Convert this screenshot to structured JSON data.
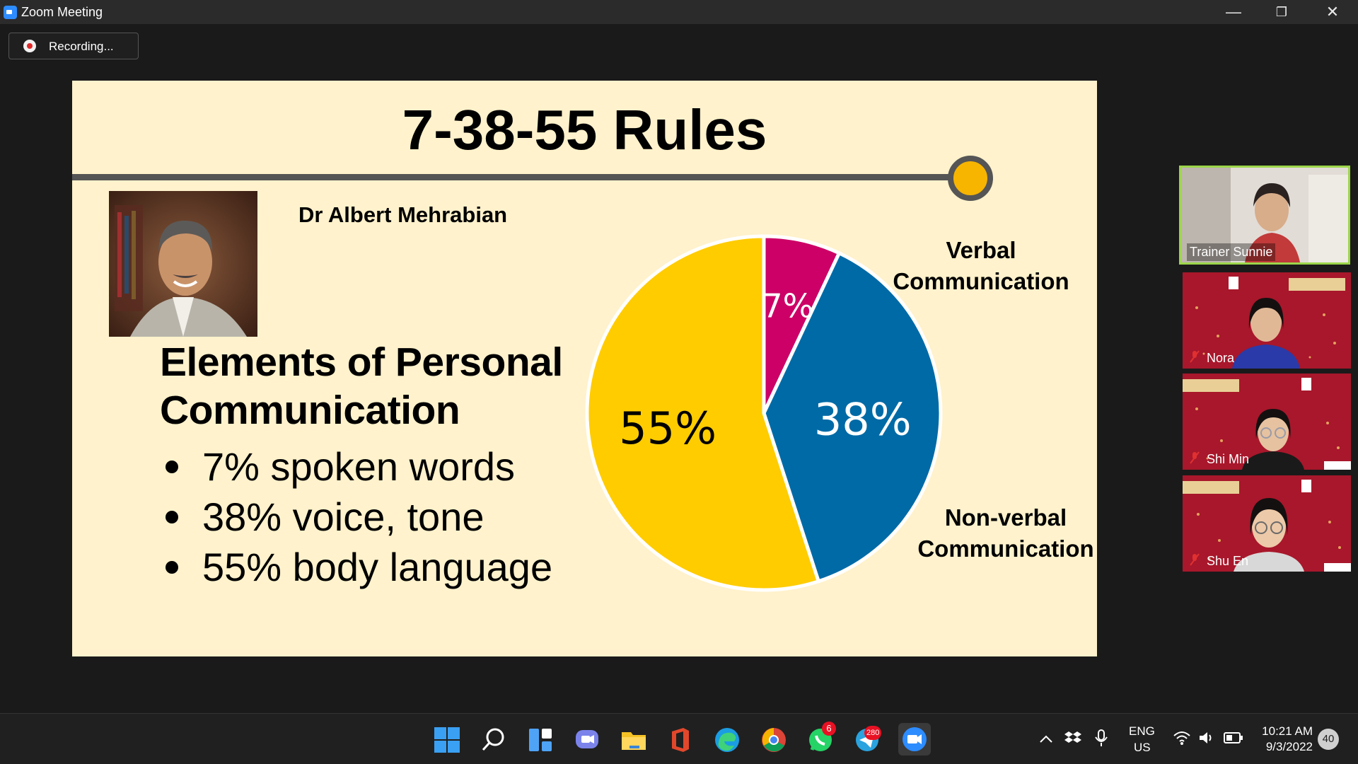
{
  "window": {
    "title": "Zoom Meeting",
    "minimize": "—",
    "restore": "❐",
    "close": "✕"
  },
  "recording": {
    "label": "Recording..."
  },
  "slide": {
    "title": "7-38-55 Rules",
    "speaker": "Dr Albert Mehrabian",
    "heading_line1": "Elements of Personal",
    "heading_line2": "Communication",
    "bullets": [
      "7% spoken words",
      "38% voice, tone",
      "55% body language"
    ],
    "label_verbal_1": "Verbal",
    "label_verbal_2": "Communication",
    "label_nonverbal_1": "Non-verbal",
    "label_nonverbal_2": "Communication",
    "pie": {
      "slices": [
        {
          "value": 7,
          "label": "7%",
          "color": "#cc0066"
        },
        {
          "value": 38,
          "label": "38%",
          "color": "#006aa6"
        },
        {
          "value": 55,
          "label": "55%",
          "color": "#ffcc00"
        }
      ]
    }
  },
  "participants": [
    {
      "name": "Trainer Sunnie"
    },
    {
      "name": "Nora"
    },
    {
      "name": "Shi Min"
    },
    {
      "name": "Shu En"
    }
  ],
  "taskbar": {
    "whatsapp_badge": "6",
    "telegram_badge": "280",
    "lang_line1": "ENG",
    "lang_line2": "US",
    "time": "10:21 AM",
    "date": "9/3/2022",
    "notification_count": "40"
  }
}
